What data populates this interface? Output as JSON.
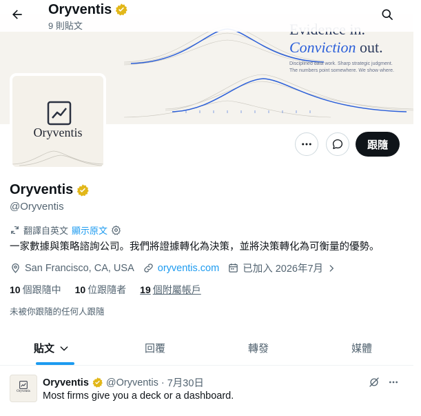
{
  "header": {
    "title": "Oryventis",
    "post_count": "9 則貼文"
  },
  "banner": {
    "line1": "Evidence in.",
    "line2_accent": "Conviction",
    "line2_rest": " out.",
    "tagline1": "Disciplined data work. Sharp strategic judgment.",
    "tagline2": "The numbers point somewhere. We show where."
  },
  "avatar": {
    "wordmark": "Oryventis"
  },
  "actions": {
    "follow_label": "跟隨"
  },
  "profile": {
    "name": "Oryventis",
    "handle": "@Oryventis",
    "translated_from": "翻譯自英文",
    "show_original": "顯示原文",
    "bio": "一家數據與策略諮詢公司。我們將證據轉化為決策，並將決策轉化為可衡量的優勢。",
    "location": "San Francisco, CA, USA",
    "website": "oryventis.com",
    "joined": "已加入 2026年7月"
  },
  "stats": {
    "following_count": "10",
    "following_label": "個跟隨中",
    "followers_count": "10",
    "followers_label": "位跟隨者",
    "affiliates_count": "19",
    "affiliates_label": "個附屬帳戶"
  },
  "not_followed_text": "未被你跟隨的任何人跟隨",
  "tabs": [
    {
      "label": "貼文"
    },
    {
      "label": "回覆"
    },
    {
      "label": "轉發"
    },
    {
      "label": "媒體"
    }
  ],
  "post": {
    "name": "Oryventis",
    "handle": "@Oryventis",
    "separator": "·",
    "date": "7月30日",
    "text": "Most firms give you a deck or a dashboard."
  },
  "colors": {
    "accent": "#1d9bf0",
    "verified_gold": "#e2b719",
    "follow_bg": "#0f1419",
    "muted_text": "#536471"
  },
  "icons": [
    "back-arrow-icon",
    "search-icon",
    "verified-badge-icon",
    "more-icon",
    "message-icon",
    "translate-icon",
    "settings-icon",
    "location-icon",
    "link-icon",
    "calendar-icon",
    "chevron-right-icon",
    "chevron-down-icon",
    "grok-icon",
    "chart-icon"
  ]
}
